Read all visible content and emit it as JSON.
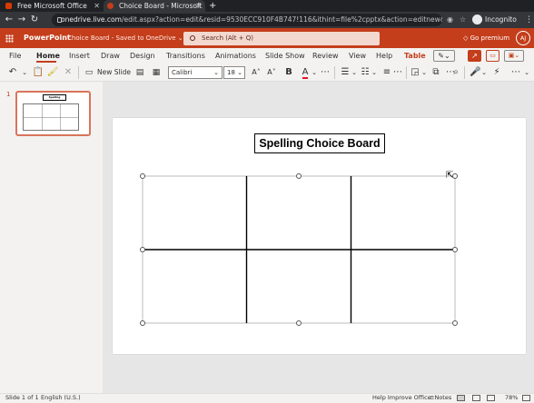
{
  "browser": {
    "tabs": [
      {
        "title": "Free Microsoft Office onlin",
        "favicon_color": "#d83b01"
      },
      {
        "title": "Choice Board - Microsoft P",
        "favicon_color": "#c43e1c"
      }
    ],
    "new_tab": "+",
    "url_host": "onedrive.live.com",
    "url_path": "/edit.aspx?action=edit&resid=9530ECC910F4B747!116&ithint=file%2cpptx&action=editnew&wdNewAndO...",
    "profile_label": "Incognito"
  },
  "office": {
    "app_name": "PowerPoint",
    "doc_title": "Choice Board",
    "save_status": "Saved to OneDrive",
    "search_placeholder": "Search (Alt + Q)",
    "premium_label": "Go premium",
    "avatar_initials": "AJ",
    "brand_color": "#c43e1c"
  },
  "ribbon": {
    "tabs": [
      "File",
      "Home",
      "Insert",
      "Draw",
      "Design",
      "Transitions",
      "Animations",
      "Slide Show",
      "Review",
      "View",
      "Help",
      "Table"
    ],
    "active_tab": "Home",
    "new_slide_label": "New Slide",
    "font_name": "Calibri",
    "font_size": "18"
  },
  "slides": [
    {
      "number": "1",
      "title": "Spelling Choice Board"
    }
  ],
  "slide": {
    "title": "Spelling Choice Board",
    "table_rows": 2,
    "table_cols": 3
  },
  "status": {
    "slide_indicator": "Slide 1 of 1",
    "language": "English (U.S.)",
    "help_improve": "Help Improve Office",
    "notes_label": "Notes",
    "zoom": "78%"
  }
}
